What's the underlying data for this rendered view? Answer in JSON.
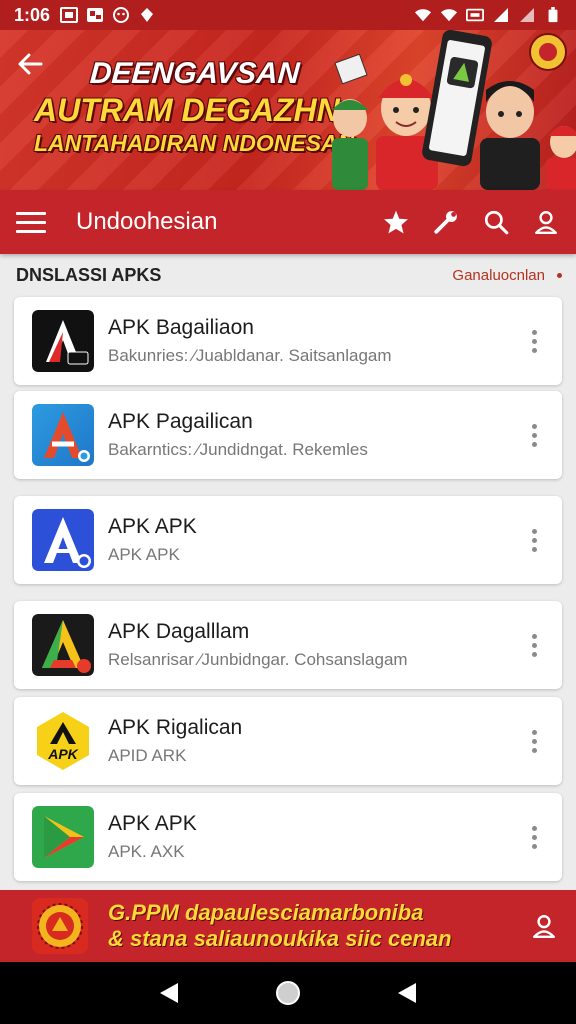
{
  "status_bar": {
    "time": "1:06",
    "left_icons": [
      "gallery-icon",
      "photo-icon",
      "face-icon",
      "bug-icon"
    ],
    "right_icons": [
      "wifi-icon",
      "wifi-icon",
      "nfc-icon",
      "signal-icon",
      "signal-icon",
      "battery-icon"
    ]
  },
  "banner": {
    "line1": "DEENGAVSAN",
    "line2": "AUTRAM DEGAZHN",
    "line3": "LANTAHADIRAN NDONESAN"
  },
  "app_bar": {
    "title": "Undoohesian",
    "actions": [
      "star-icon",
      "wrench-icon",
      "search-icon",
      "user-icon"
    ]
  },
  "section": {
    "title": "DNSLASSI APKS",
    "link": "Ganaluocnlan"
  },
  "apps": [
    {
      "name": "APK Bagailiaon",
      "subtitle": "Bakunries: ⁄Juabldanar. Saitsanlagam",
      "icon": "apk-icon-black",
      "colors": [
        "#111111",
        "#e02a2a",
        "#ffffff"
      ]
    },
    {
      "name": "APK Pagailican",
      "subtitle": "Bakarntics: ⁄Jundidngat. Rekemles",
      "icon": "apk-icon-blue-red",
      "colors": [
        "#2d9be0",
        "#e44a2c",
        "#ffffff"
      ]
    },
    {
      "name": "APK  APK",
      "subtitle": "APK  APK",
      "icon": "apk-icon-blue",
      "colors": [
        "#2c50d8",
        "#ffffff"
      ]
    },
    {
      "name": "APK Dagalllam",
      "subtitle": "Relsanrisar ⁄Junbidngar. Cohsanslagam",
      "icon": "apk-icon-tricolor",
      "colors": [
        "#1a1a1a",
        "#e63a2a",
        "#3bb04a",
        "#f5c21a"
      ]
    },
    {
      "name": "APK Rigalican",
      "subtitle": "APID ARK",
      "icon": "apk-icon-yellow",
      "colors": [
        "#f7d117",
        "#111111"
      ],
      "icon_label": "APK"
    },
    {
      "name": "APK APK",
      "subtitle": "APK. AXK",
      "icon": "apk-icon-play",
      "colors": [
        "#2ea84a",
        "#f2c21b",
        "#e63b2e"
      ]
    }
  ],
  "bottom_banner": {
    "line1": "G.PPM dapaulesciamarboniba",
    "line2": "& stana saliaunoukika siic cenan",
    "icon": "emblem-icon"
  },
  "nav": [
    "back-nav-icon",
    "home-nav-icon",
    "recents-nav-icon"
  ],
  "colors": {
    "primary": "#c4252a",
    "banner_text_yellow": "#ffd83a",
    "link": "#b53220",
    "background": "#ececec"
  }
}
